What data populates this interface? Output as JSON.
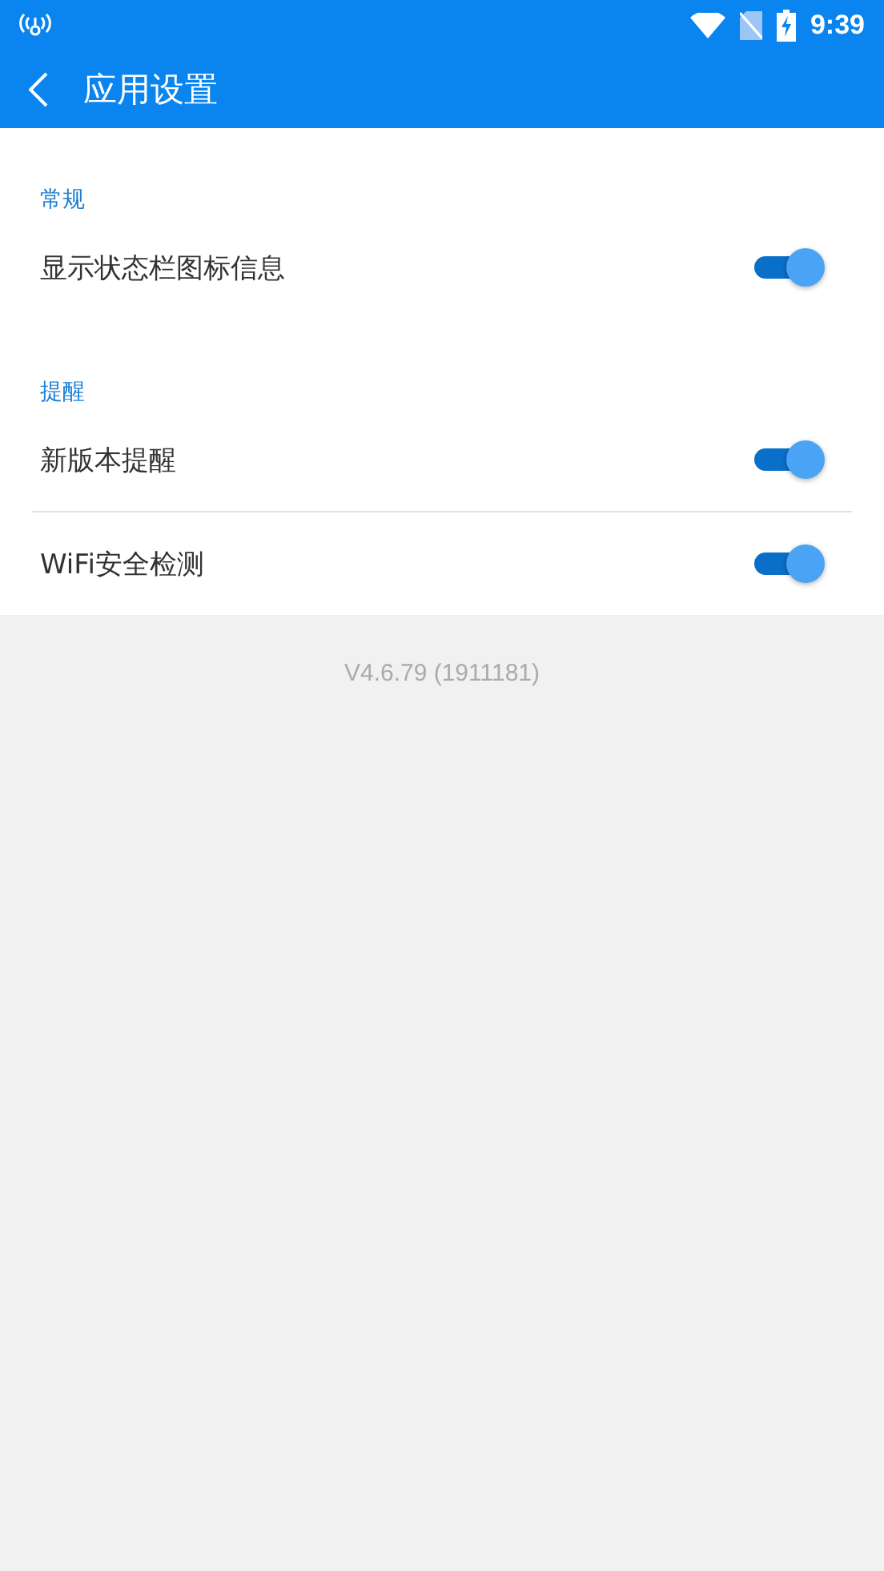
{
  "status_bar": {
    "time": "9:39"
  },
  "toolbar": {
    "title": "应用设置"
  },
  "sections": [
    {
      "heading": "常规",
      "items": [
        {
          "label": "显示状态栏图标信息",
          "on": true
        }
      ]
    },
    {
      "heading": "提醒",
      "items": [
        {
          "label": "新版本提醒",
          "on": true
        },
        {
          "label": "WiFi安全检测",
          "on": true
        }
      ]
    }
  ],
  "version": "V4.6.79 (1911181)"
}
